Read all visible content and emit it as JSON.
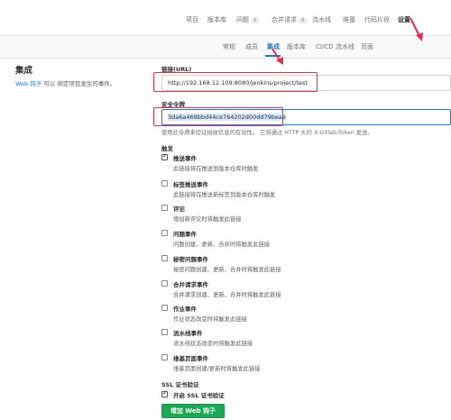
{
  "topnav": {
    "items": [
      {
        "label": "项目"
      },
      {
        "label": "版本库"
      },
      {
        "label": "问题",
        "count": "0"
      },
      {
        "label": "合并请求",
        "count": "0"
      },
      {
        "label": "流水线"
      },
      {
        "label": "维基"
      },
      {
        "label": "代码片段"
      },
      {
        "label": "设置"
      }
    ]
  },
  "subnav": {
    "items": [
      {
        "label": "常规"
      },
      {
        "label": "成员"
      },
      {
        "label": "集成"
      },
      {
        "label": "版本库"
      },
      {
        "label": "CI/CD 流水线"
      },
      {
        "label": "页面"
      }
    ]
  },
  "side": {
    "title": "集成",
    "link": "Web 钩子",
    "desc": "可以 绑定项目发生的事件。"
  },
  "url": {
    "label": "链接(URL)",
    "value": "http://192.168.12.109:8080/jenkins/project/test"
  },
  "token": {
    "label": "安全令牌",
    "value": "3da6a469bbd44ce764202d00dd79beae",
    "help": "使用此令牌来验证接收信息的有效性。 它将通过 HTTP 头的 X-Gitlab-Token 发送。"
  },
  "trigger": {
    "label": "触发",
    "items": [
      {
        "label": "推送事件",
        "desc": "此链接将在推送到版本仓库时触发",
        "checked": true
      },
      {
        "label": "标签推送事件",
        "desc": "此链接将在推送新标签到版本仓库时触发",
        "checked": false
      },
      {
        "label": "评论",
        "desc": "增加新评论时将触发此链接",
        "checked": false
      },
      {
        "label": "问题事件",
        "desc": "问题创建、更新、合并时将触发此链接",
        "checked": false
      },
      {
        "label": "秘密问题事件",
        "desc": "秘密问题创建、更新、合并时将触发此链接",
        "checked": false
      },
      {
        "label": "合并请求事件",
        "desc": "合并请求创建、更新、合并时将触发此链接",
        "checked": false
      },
      {
        "label": "作业事件",
        "desc": "作业状态改变时将触发此链接",
        "checked": false
      },
      {
        "label": "流水线事件",
        "desc": "流水线状态改变时将触发此链接",
        "checked": false
      },
      {
        "label": "维基页面事件",
        "desc": "维基页面创建/更新时将触发此链接",
        "checked": false
      }
    ]
  },
  "ssl": {
    "label": "SSL 证书验证",
    "option": "开启 SSL 证书验证",
    "checked": true
  },
  "submit": {
    "label": "增加 Web 钩子"
  },
  "colors": {
    "accent": "#1f78d1",
    "annotation": "#e0314b",
    "success": "#1aaa55"
  }
}
